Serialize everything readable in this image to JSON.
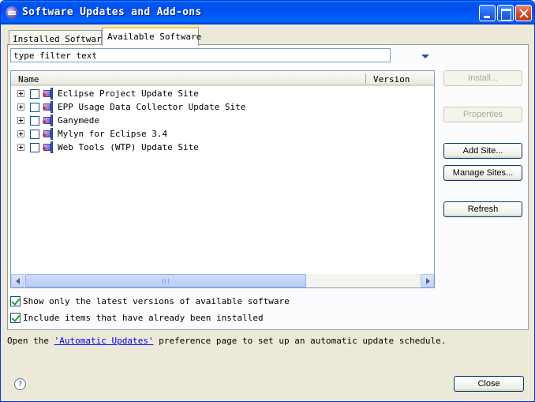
{
  "window": {
    "title": "Software Updates and Add-ons",
    "icon": "eclipse-icon"
  },
  "tabs": [
    {
      "label": "Installed Software",
      "selected": false
    },
    {
      "label": "Available Software",
      "selected": true
    }
  ],
  "filter": {
    "value": "type filter text"
  },
  "tree": {
    "columns": [
      "Name",
      "Version"
    ],
    "rows": [
      {
        "label": "Eclipse Project Update Site",
        "checked": false
      },
      {
        "label": "EPP Usage Data Collector Update Site",
        "checked": false
      },
      {
        "label": "Ganymede",
        "checked": false
      },
      {
        "label": "Mylyn for Eclipse 3.4",
        "checked": false
      },
      {
        "label": "Web Tools (WTP) Update Site",
        "checked": false
      }
    ]
  },
  "buttons": {
    "install": "Install...",
    "properties": "Properties",
    "add_site": "Add Site...",
    "manage_sites": "Manage Sites...",
    "refresh": "Refresh",
    "close": "Close"
  },
  "options": {
    "latest_only": {
      "label": "Show only the latest versions of available software",
      "checked": true
    },
    "include_installed": {
      "label": "Include items that have already been installed",
      "checked": true
    }
  },
  "footer": {
    "prefix": "Open the ",
    "link": "'Automatic Updates'",
    "suffix": " preference page to set up an automatic update schedule."
  },
  "help": {
    "glyph": "?"
  }
}
